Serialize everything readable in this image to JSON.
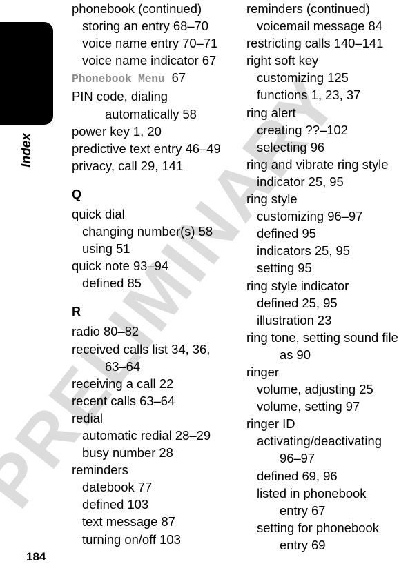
{
  "page": {
    "number": "184",
    "tab_label": "Index",
    "watermark": "PRELIMINARY",
    "watermark_color": "#dcdcdc",
    "tab_color": "#000000",
    "screen_term_color": "#8c8c8c"
  },
  "left_column": [
    {
      "kind": "entry",
      "level": 0,
      "text": "phonebook (continued)"
    },
    {
      "kind": "entry",
      "level": 1,
      "text": "storing an entry  68–70"
    },
    {
      "kind": "entry",
      "level": 1,
      "text": "voice name entry  70–71"
    },
    {
      "kind": "entry",
      "level": 1,
      "text": "voice name indicator  67"
    },
    {
      "kind": "screen",
      "level": 0,
      "term": "Phonebook Menu",
      "pages": "67"
    },
    {
      "kind": "entry",
      "level": 0,
      "text": "PIN code, dialing"
    },
    {
      "kind": "entry",
      "level": 2,
      "text": "automatically  58"
    },
    {
      "kind": "entry",
      "level": 0,
      "text": "power key  1, 20"
    },
    {
      "kind": "entry",
      "level": 0,
      "text": "predictive text entry  46–49"
    },
    {
      "kind": "entry",
      "level": 0,
      "text": "privacy, call  29, 141"
    },
    {
      "kind": "letter",
      "text": "Q"
    },
    {
      "kind": "entry",
      "level": 0,
      "text": "quick dial"
    },
    {
      "kind": "entry",
      "level": 1,
      "text": "changing number(s)  58"
    },
    {
      "kind": "entry",
      "level": 1,
      "text": "using  51"
    },
    {
      "kind": "entry",
      "level": 0,
      "text": "quick note  93–94"
    },
    {
      "kind": "entry",
      "level": 1,
      "text": "defined  85"
    },
    {
      "kind": "letter",
      "text": "R"
    },
    {
      "kind": "entry",
      "level": 0,
      "text": "radio  80–82"
    },
    {
      "kind": "entry",
      "level": 0,
      "text": "received calls list  34, 36,"
    },
    {
      "kind": "entry",
      "level": 2,
      "text": "63–64"
    },
    {
      "kind": "entry",
      "level": 0,
      "text": "receiving a call  22"
    },
    {
      "kind": "entry",
      "level": 0,
      "text": "recent calls  63–64"
    },
    {
      "kind": "entry",
      "level": 0,
      "text": "redial"
    },
    {
      "kind": "entry",
      "level": 1,
      "text": "automatic redial  28–29"
    },
    {
      "kind": "entry",
      "level": 1,
      "text": "busy number  28"
    },
    {
      "kind": "entry",
      "level": 0,
      "text": "reminders"
    },
    {
      "kind": "entry",
      "level": 1,
      "text": "datebook  77"
    },
    {
      "kind": "entry",
      "level": 1,
      "text": "defined  103"
    },
    {
      "kind": "entry",
      "level": 1,
      "text": "text message  87"
    },
    {
      "kind": "entry",
      "level": 1,
      "text": "turning on/off  103"
    }
  ],
  "right_column": [
    {
      "kind": "entry",
      "level": 0,
      "text": "reminders (continued)"
    },
    {
      "kind": "entry",
      "level": 1,
      "text": "voicemail message  84"
    },
    {
      "kind": "entry",
      "level": 0,
      "text": "restricting calls  140–141"
    },
    {
      "kind": "entry",
      "level": 0,
      "text": "right soft key"
    },
    {
      "kind": "entry",
      "level": 1,
      "text": "customizing  125"
    },
    {
      "kind": "entry",
      "level": 1,
      "text": "functions  1, 23, 37"
    },
    {
      "kind": "entry",
      "level": 0,
      "text": "ring alert"
    },
    {
      "kind": "entry",
      "level": 1,
      "text": "creating  ??–102"
    },
    {
      "kind": "entry",
      "level": 1,
      "text": "selecting  96"
    },
    {
      "kind": "entry",
      "level": 0,
      "text": "ring and vibrate ring style"
    },
    {
      "kind": "entry",
      "level": 1,
      "text": "indicator  25, 95"
    },
    {
      "kind": "entry",
      "level": 0,
      "text": "ring style"
    },
    {
      "kind": "entry",
      "level": 1,
      "text": "customizing  96–97"
    },
    {
      "kind": "entry",
      "level": 1,
      "text": "defined  95"
    },
    {
      "kind": "entry",
      "level": 1,
      "text": "indicators  25, 95"
    },
    {
      "kind": "entry",
      "level": 1,
      "text": "setting  95"
    },
    {
      "kind": "entry",
      "level": 0,
      "text": "ring style indicator"
    },
    {
      "kind": "entry",
      "level": 1,
      "text": "defined  25, 95"
    },
    {
      "kind": "entry",
      "level": 1,
      "text": "illustration  23"
    },
    {
      "kind": "entry",
      "level": 0,
      "text": "ring tone, setting sound file"
    },
    {
      "kind": "entry",
      "level": 2,
      "text": "as  90"
    },
    {
      "kind": "entry",
      "level": 0,
      "text": "ringer"
    },
    {
      "kind": "entry",
      "level": 1,
      "text": "volume, adjusting  25"
    },
    {
      "kind": "entry",
      "level": 1,
      "text": "volume, setting  97"
    },
    {
      "kind": "entry",
      "level": 0,
      "text": "ringer ID"
    },
    {
      "kind": "entry",
      "level": 1,
      "text": "activating/deactivating"
    },
    {
      "kind": "entry",
      "level": 2,
      "text": "96–97"
    },
    {
      "kind": "entry",
      "level": 1,
      "text": "defined  69, 96"
    },
    {
      "kind": "entry",
      "level": 1,
      "text": "listed in phonebook"
    },
    {
      "kind": "entry",
      "level": 2,
      "text": "entry  67"
    },
    {
      "kind": "entry",
      "level": 1,
      "text": "setting for phonebook"
    },
    {
      "kind": "entry",
      "level": 2,
      "text": "entry  69"
    }
  ]
}
